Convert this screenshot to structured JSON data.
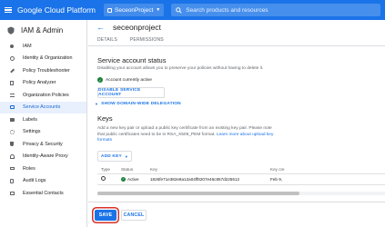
{
  "topbar": {
    "app_title": "Google Cloud Platform",
    "project_name": "SeceonProject",
    "search_placeholder": "Search products and resources"
  },
  "sidebar": {
    "title": "IAM & Admin",
    "items": [
      {
        "label": "IAM",
        "icon": "person-add-icon"
      },
      {
        "label": "Identity & Organization",
        "icon": "person-circle-icon"
      },
      {
        "label": "Policy Troubleshooter",
        "icon": "wrench-icon"
      },
      {
        "label": "Policy Analyzer",
        "icon": "document-search-icon"
      },
      {
        "label": "Organization Policies",
        "icon": "list-icon"
      },
      {
        "label": "Service Accounts",
        "icon": "service-account-icon",
        "active": true
      },
      {
        "label": "Labels",
        "icon": "label-icon"
      },
      {
        "label": "Settings",
        "icon": "gear-icon"
      },
      {
        "label": "Privacy & Security",
        "icon": "shield-icon"
      },
      {
        "label": "Identity-Aware Proxy",
        "icon": "proxy-icon"
      },
      {
        "label": "Roles",
        "icon": "roles-icon"
      },
      {
        "label": "Audit Logs",
        "icon": "audit-icon"
      },
      {
        "label": "Essential Contacts",
        "icon": "contacts-icon"
      }
    ]
  },
  "main": {
    "page_title": "seceonproject",
    "tabs": [
      "DETAILS",
      "PERMISSIONS"
    ],
    "status_section": {
      "title": "Service account status",
      "description": "Disabling your account allows you to preserve your policies without having to delete it.",
      "status_text": "Account currently active",
      "disable_button": "DISABLE SERVICE ACCOUNT",
      "delegation_link": "SHOW DOMAIN-WIDE DELEGATION"
    },
    "keys_section": {
      "title": "Keys",
      "description": "Add a new key pair or upload a public key certificate from an existing key pair. Please note that public certificates need to be in RSA_X509_PEM format.",
      "learn_more": "Learn more about upload key formats",
      "add_key_button": "ADD KEY",
      "columns": [
        "Type",
        "Status",
        "Key",
        "Key cre"
      ],
      "rows": [
        {
          "status": "Active",
          "key": "1826fe71e382e8a12a04ff8207e46c857d225512",
          "created": "Feb 9,"
        }
      ]
    }
  },
  "footer": {
    "save_label": "SAVE",
    "cancel_label": "CANCEL"
  },
  "colors": {
    "brand_blue": "#1a73e8",
    "active_green": "#188038",
    "highlight_red": "#d93025"
  }
}
